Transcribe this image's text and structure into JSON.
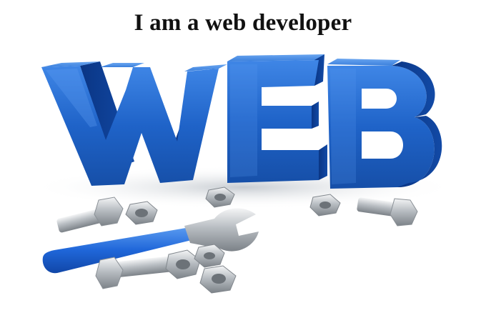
{
  "caption": "I am a web developer",
  "illustration": {
    "word": "WEB",
    "letters": [
      "W",
      "E",
      "B"
    ],
    "colors": {
      "letter_face": "#1f63c8",
      "letter_side": "#0c3f97",
      "wrench": "#1f66d9",
      "metal": "#c3c8cd"
    }
  }
}
